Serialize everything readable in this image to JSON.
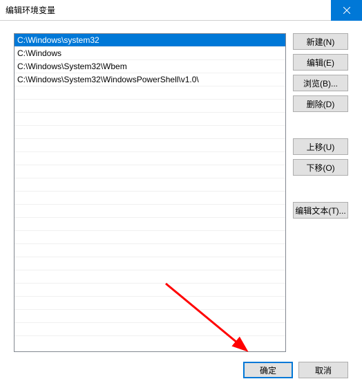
{
  "window": {
    "title": "编辑环境变量"
  },
  "list": {
    "items": [
      "C:\\Windows\\system32",
      "C:\\Windows",
      "C:\\Windows\\System32\\Wbem",
      "C:\\Windows\\System32\\WindowsPowerShell\\v1.0\\"
    ],
    "selected_index": 0
  },
  "buttons": {
    "new": "新建(N)",
    "edit": "编辑(E)",
    "browse": "浏览(B)...",
    "delete": "删除(D)",
    "move_up": "上移(U)",
    "move_down": "下移(O)",
    "edit_text": "编辑文本(T)...",
    "ok": "确定",
    "cancel": "取消"
  },
  "colors": {
    "accent": "#0078d7",
    "arrow": "#ff0000"
  }
}
